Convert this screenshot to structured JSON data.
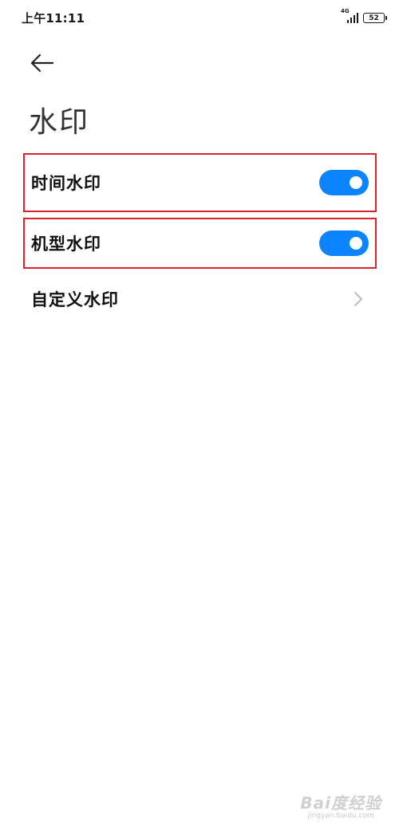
{
  "status_bar": {
    "time": "上午11:11",
    "network": "4G",
    "battery": "52"
  },
  "header": {
    "back_icon": "back-arrow-icon",
    "title": "水印"
  },
  "settings": {
    "items": [
      {
        "label": "时间水印",
        "control": "toggle",
        "enabled": true,
        "highlighted": true
      },
      {
        "label": "机型水印",
        "control": "toggle",
        "enabled": true,
        "highlighted": true
      },
      {
        "label": "自定义水印",
        "control": "chevron",
        "icon": "chevron-right-icon"
      }
    ]
  },
  "colors": {
    "toggle_on": "#0d84ff",
    "highlight_border": "#d9242e",
    "title": "#333333"
  },
  "watermark": {
    "logo": "Bai度经验",
    "url": "jingyan.baidu.com"
  }
}
